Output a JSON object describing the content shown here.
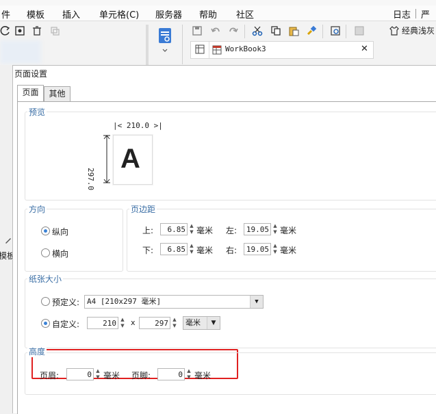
{
  "menu": {
    "items": [
      "件",
      "模板",
      "插入",
      "单元格(C)",
      "服务器",
      "帮助",
      "社区"
    ],
    "right_items": [
      "日志",
      "严重"
    ]
  },
  "workbook_tab": "WorkBook3",
  "left_partial_label": "模板排",
  "dialog": {
    "title": "页面设置",
    "tabs": [
      "页面",
      "其他"
    ],
    "preview": {
      "label": "预览",
      "width_text": "210.0",
      "height_text": "297.0",
      "letter": "A"
    },
    "orientation": {
      "label": "方向",
      "portrait": "纵向",
      "landscape": "横向"
    },
    "margins": {
      "label": "页边距",
      "top_label": "上:",
      "top_value": "6.85",
      "bottom_label": "下:",
      "bottom_value": "6.85",
      "left_label": "左:",
      "left_value": "19.05",
      "right_label": "右:",
      "right_value": "19.05",
      "unit": "毫米"
    },
    "paper": {
      "label": "纸张大小",
      "predefined_label": "预定义:",
      "predefined_value": "A4 [210x297 毫米]",
      "custom_label": "自定义:",
      "custom_width": "210",
      "times": "x",
      "custom_height": "297",
      "unit_value": "毫米"
    },
    "height": {
      "label": "高度",
      "header_label": "页眉:",
      "header_value": "0",
      "footer_label": "页脚:",
      "footer_value": "0",
      "unit": "毫米"
    }
  }
}
